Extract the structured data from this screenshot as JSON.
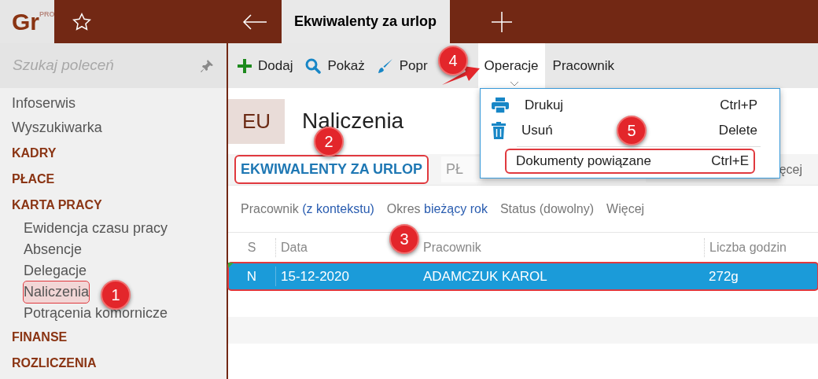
{
  "logo": {
    "text": "Gr",
    "sup": "PRO"
  },
  "window_tab": {
    "label": "Ekwiwalenty za urlop",
    "selected": true
  },
  "search": {
    "placeholder": "Szukaj poleceń"
  },
  "sidebar": {
    "items": [
      {
        "label": "Infoserwis",
        "kind": "link",
        "selected": false
      },
      {
        "label": "Wyszukiwarka",
        "kind": "link",
        "selected": false
      },
      {
        "label": "KADRY",
        "kind": "section",
        "selected": false
      },
      {
        "label": "PŁACE",
        "kind": "section",
        "selected": false
      },
      {
        "label": "KARTA PRACY",
        "kind": "section",
        "selected": false,
        "children": [
          {
            "label": "Ewidencja czasu pracy",
            "kind": "link",
            "selected": false
          },
          {
            "label": "Absencje",
            "kind": "link",
            "selected": false
          },
          {
            "label": "Delegacje",
            "kind": "link",
            "selected": false
          },
          {
            "label": "Naliczenia",
            "kind": "link",
            "selected": true,
            "outlined": true
          },
          {
            "label": "Potrącenia komornicze",
            "kind": "link",
            "selected": false
          }
        ]
      },
      {
        "label": "FINANSE",
        "kind": "section",
        "selected": false
      },
      {
        "label": "ROZLICZENIA",
        "kind": "section",
        "selected": false
      }
    ]
  },
  "toolbar": [
    {
      "label": "Dodaj",
      "kind": "add",
      "selected": false
    },
    {
      "label": "Pokaż",
      "kind": "search",
      "selected": false
    },
    {
      "label": "Popr",
      "kind": "brush",
      "selected": false
    },
    {
      "label": "Operacje",
      "kind": "menu",
      "selected": true
    },
    {
      "label": "Pracownik",
      "kind": "plain",
      "selected": false
    }
  ],
  "page": {
    "badge": "EU",
    "title": "Naliczenia"
  },
  "tabs": [
    {
      "label": "EKWIWALENTY ZA URLOP",
      "selected": true,
      "outlined": true
    },
    {
      "label": "PŁ",
      "selected": false,
      "outlined": false
    }
  ],
  "tabs_more": "ęcej",
  "filters": [
    {
      "label": "Pracownik",
      "value": "(z kontekstu)",
      "set": true
    },
    {
      "label": "Okres",
      "value": "bieżący rok",
      "set": true
    },
    {
      "label": "Status",
      "value": "(dowolny)",
      "set": false
    },
    {
      "label": "Więcej"
    }
  ],
  "table": {
    "columns": [
      "S",
      "Data",
      "Pracownik",
      "Liczba godzin"
    ],
    "rows": [
      {
        "cells": [
          "N",
          "15-12-2020",
          "ADAMCZUK KAROL",
          "272g"
        ],
        "selected": true,
        "outlined": true
      }
    ]
  },
  "menu": {
    "items": [
      {
        "label": "Drukuj",
        "shortcut": "Ctrl+P",
        "kind": "print",
        "outlined": false
      },
      {
        "label": "Usuń",
        "shortcut": "Delete",
        "kind": "delete",
        "outlined": false
      },
      {
        "kind": "separator"
      },
      {
        "label": "Dokumenty powiązane",
        "shortcut": "Ctrl+E",
        "kind": "plain",
        "outlined": true
      }
    ]
  },
  "markers": [
    {
      "label": "1",
      "kind": "badge"
    },
    {
      "label": "2",
      "kind": "badge"
    },
    {
      "label": "3",
      "kind": "badge"
    },
    {
      "label": "4",
      "kind": "arrow"
    },
    {
      "label": "5",
      "kind": "badge"
    }
  ]
}
